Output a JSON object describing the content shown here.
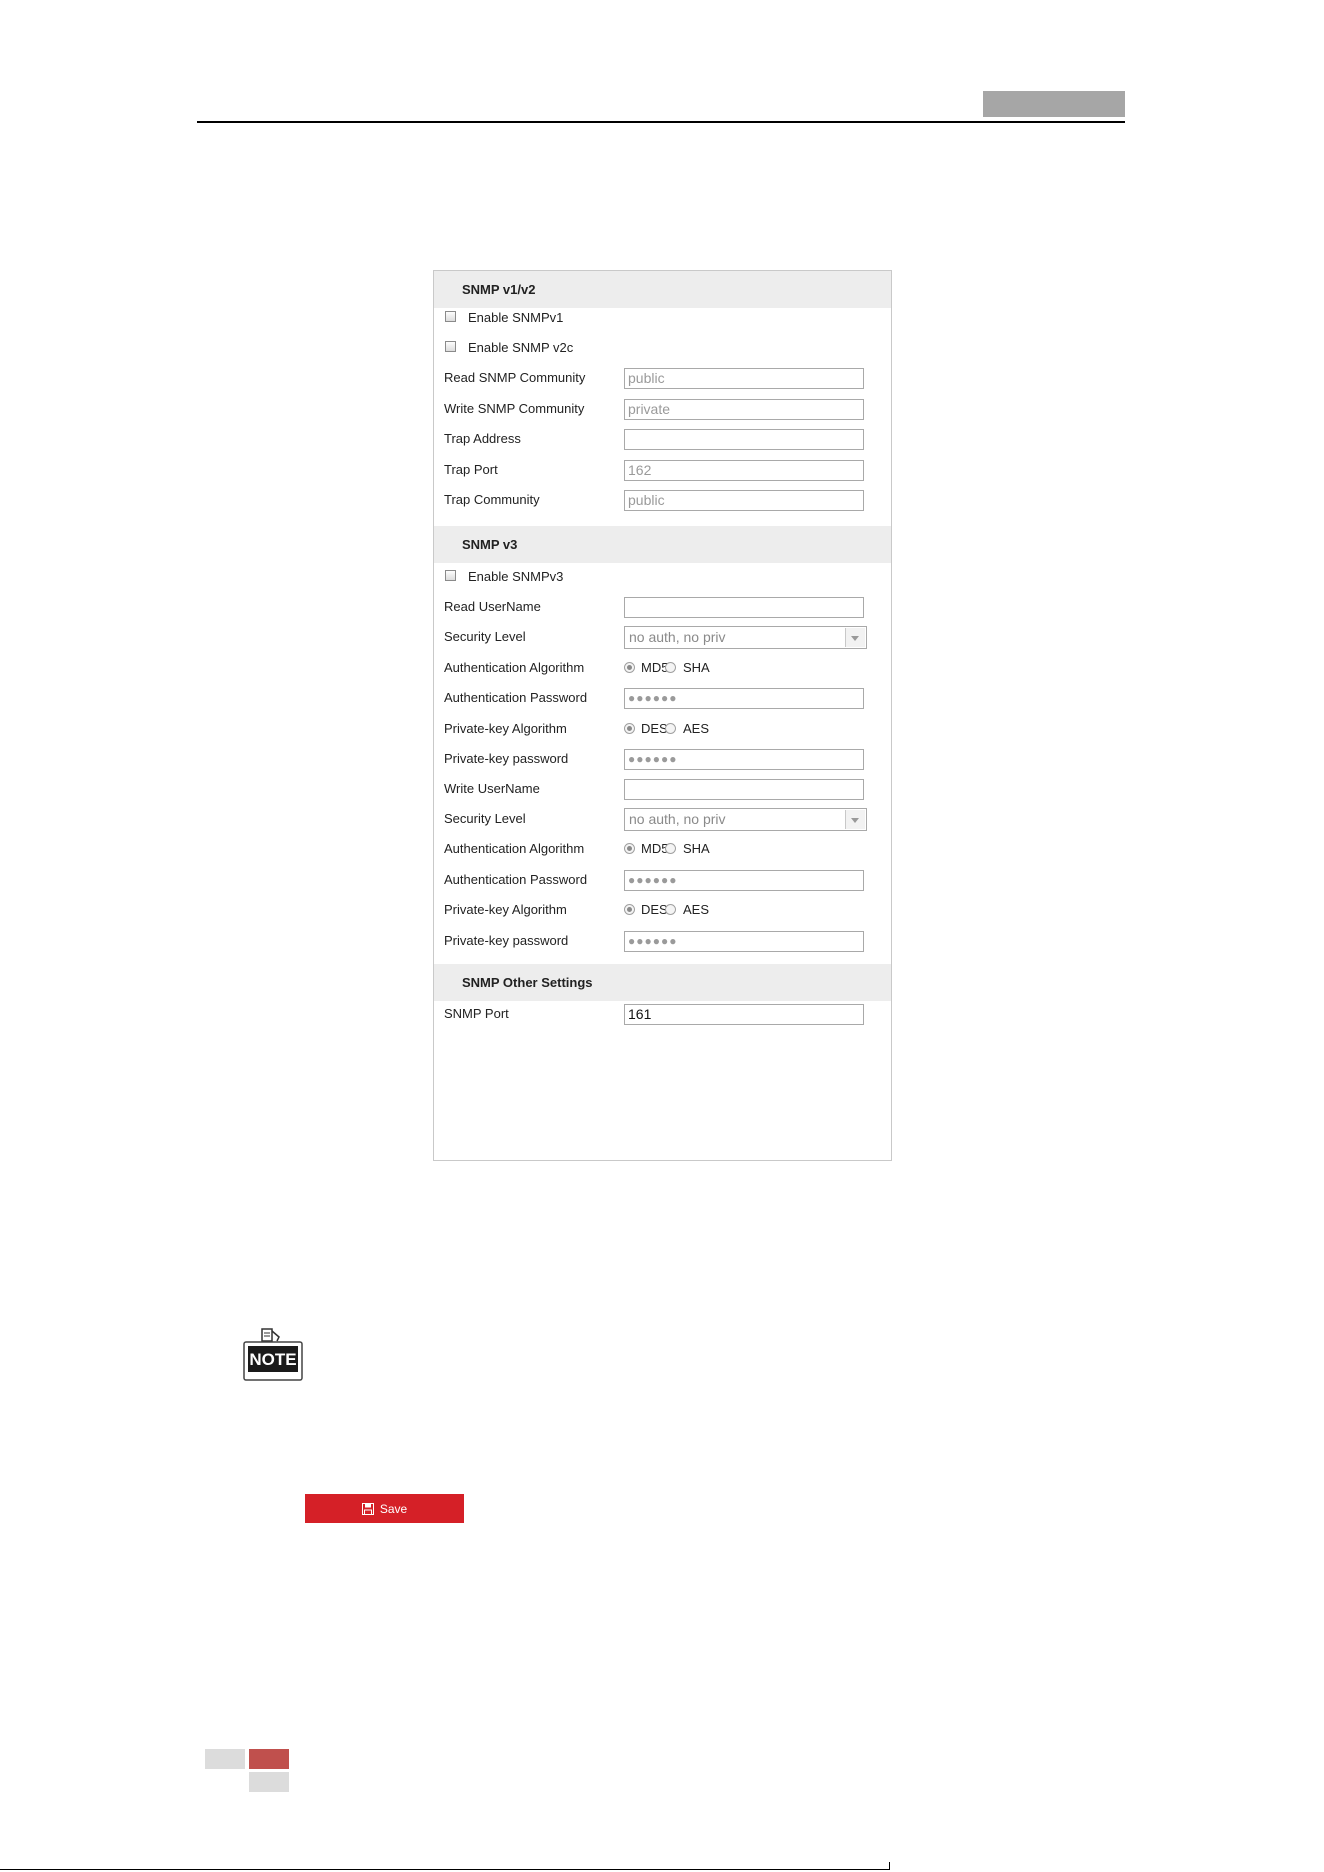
{
  "snmp_v1v2": {
    "title": "SNMP v1/v2",
    "enable_v1": "Enable SNMPv1",
    "enable_v2c": "Enable SNMP v2c",
    "read_community": {
      "label": "Read SNMP Community",
      "value": "public"
    },
    "write_community": {
      "label": "Write SNMP Community",
      "value": "private"
    },
    "trap_address": {
      "label": "Trap Address",
      "value": ""
    },
    "trap_port": {
      "label": "Trap Port",
      "value": "162"
    },
    "trap_community": {
      "label": "Trap Community",
      "value": "public"
    }
  },
  "snmp_v3": {
    "title": "SNMP v3",
    "enable_v3": "Enable SNMPv3",
    "read_username": {
      "label": "Read UserName",
      "value": ""
    },
    "read_security_level": {
      "label": "Security Level",
      "value": "no auth, no priv"
    },
    "read_auth_algorithm": {
      "label": "Authentication Algorithm",
      "option1": "MD5",
      "option2": "SHA"
    },
    "read_auth_password": {
      "label": "Authentication Password",
      "value": "●●●●●●"
    },
    "read_privkey_algorithm": {
      "label": "Private-key Algorithm",
      "option1": "DES",
      "option2": "AES"
    },
    "read_privkey_password": {
      "label": "Private-key password",
      "value": "●●●●●●"
    },
    "write_username": {
      "label": "Write UserName",
      "value": ""
    },
    "write_security_level": {
      "label": "Security Level",
      "value": "no auth, no priv"
    },
    "write_auth_algorithm": {
      "label": "Authentication Algorithm",
      "option1": "MD5",
      "option2": "SHA"
    },
    "write_auth_password": {
      "label": "Authentication Password",
      "value": "●●●●●●"
    },
    "write_privkey_algorithm": {
      "label": "Private-key Algorithm",
      "option1": "DES",
      "option2": "AES"
    },
    "write_privkey_password": {
      "label": "Private-key password",
      "value": "●●●●●●"
    }
  },
  "snmp_other": {
    "title": "SNMP Other Settings",
    "snmp_port": {
      "label": "SNMP Port",
      "value": "161"
    }
  },
  "note": {
    "icon_text": "NOTE"
  },
  "save_button": {
    "label": "Save"
  },
  "colors": {
    "save_button": "#d52027",
    "section_header_bg": "#ededed",
    "footer_accent": "#c0504d"
  }
}
